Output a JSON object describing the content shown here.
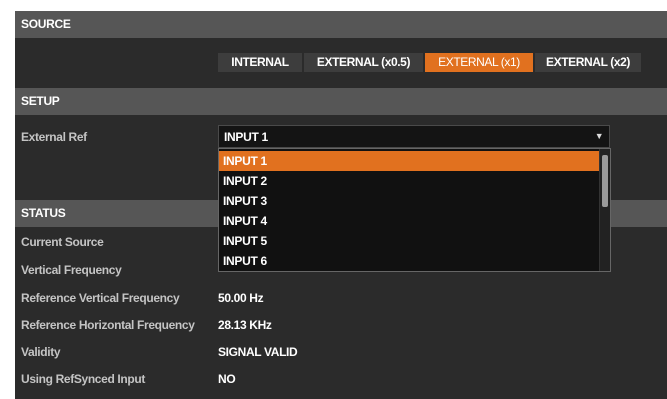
{
  "source": {
    "header": "SOURCE",
    "buttons": [
      "INTERNAL",
      "EXTERNAL (x0.5)",
      "EXTERNAL (x1)",
      "EXTERNAL (x2)"
    ],
    "active_index": 2
  },
  "setup": {
    "header": "SETUP",
    "external_ref_label": "External Ref",
    "external_ref_value": "INPUT 1",
    "options": [
      "INPUT 1",
      "INPUT 2",
      "INPUT 3",
      "INPUT 4",
      "INPUT 5",
      "INPUT 6"
    ],
    "highlighted_index": 0
  },
  "status": {
    "header": "STATUS",
    "rows": [
      {
        "label": "Current Source",
        "value": ""
      },
      {
        "label": "Vertical Frequency",
        "value": ""
      },
      {
        "label": "Reference Vertical Frequency",
        "value": "50.00 Hz"
      },
      {
        "label": "Reference Horizontal Frequency",
        "value": "28.13 KHz"
      },
      {
        "label": "Validity",
        "value": "SIGNAL VALID"
      },
      {
        "label": "Using RefSynced Input",
        "value": "NO"
      }
    ]
  },
  "colors": {
    "accent": "#e1711f",
    "panel_bg": "#2b2b2b",
    "header_bg": "#565656"
  }
}
